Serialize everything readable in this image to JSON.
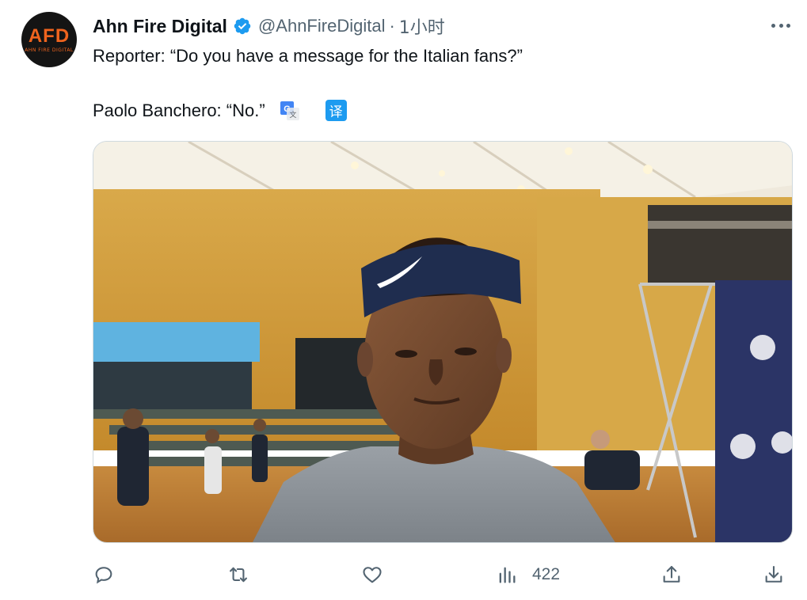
{
  "author": {
    "display_name": "Ahn Fire Digital",
    "handle": "@AhnFireDigital",
    "separator": "·",
    "timestamp": "1小时",
    "avatar_text": "AFD",
    "avatar_subtext": "AHN FIRE DIGITAL",
    "verified_icon": "verified-badge-icon",
    "brand_color": "#f0641e"
  },
  "tweet": {
    "line1": "Reporter: “Do you have a message for the Italian fans?”",
    "line2": "Paolo Banchero: “No.”",
    "translate_badge": "译"
  },
  "media": {
    "type": "video-frame",
    "description_icon": "video-thumbnail"
  },
  "actions": {
    "reply_icon": "reply-icon",
    "retweet_icon": "retweet-icon",
    "like_icon": "like-icon",
    "views_icon": "views-icon",
    "views_count": "422",
    "share_icon": "share-icon",
    "download_icon": "download-icon"
  },
  "colors": {
    "verified_blue": "#1d9bf0",
    "text_primary": "#0f1419",
    "text_secondary": "#536471"
  }
}
